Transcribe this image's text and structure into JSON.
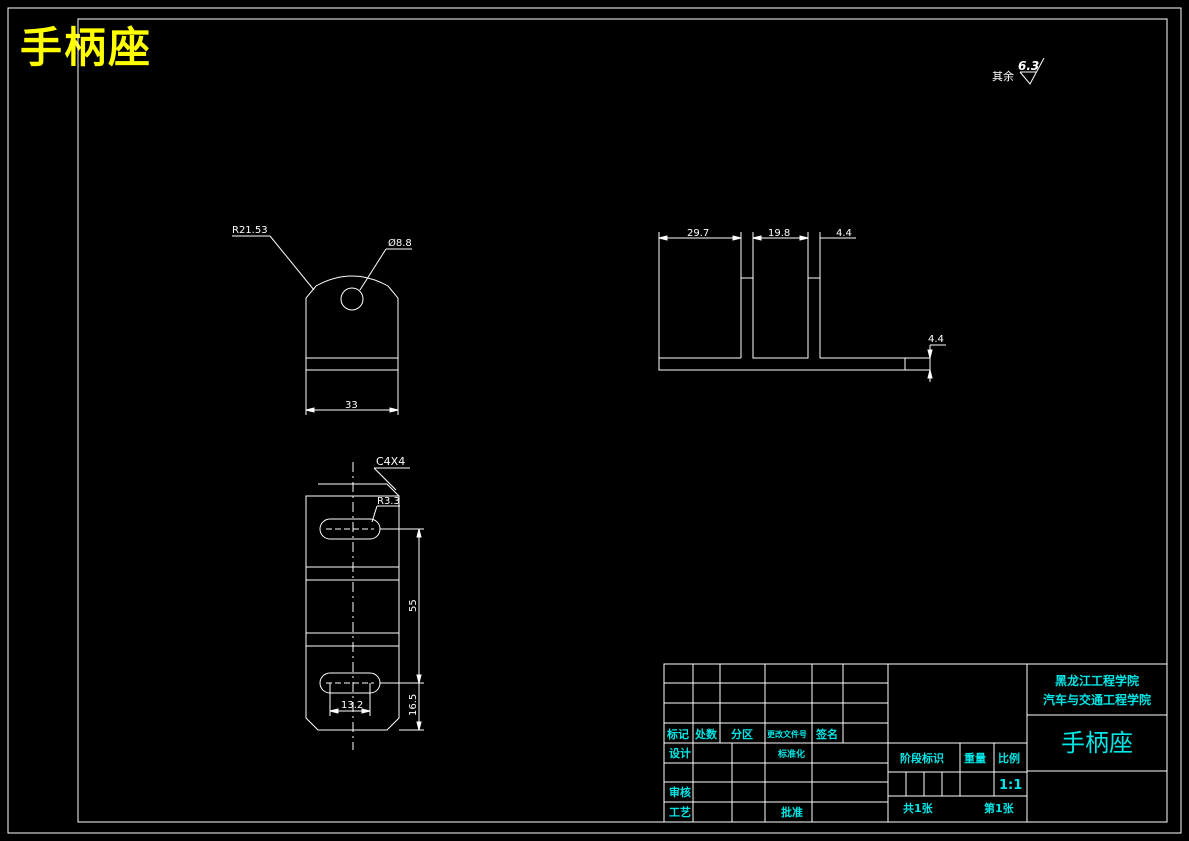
{
  "drawing": {
    "title": "手柄座",
    "surface_finish": {
      "prefix": "其余",
      "value": "6.3"
    }
  },
  "front_view": {
    "radius_label": "R21.53",
    "hole_label": "Ø8.8",
    "width_label": "33"
  },
  "side_view": {
    "dim_a": "29.7",
    "dim_b": "19.8",
    "dim_c": "4.4",
    "thickness": "4.4"
  },
  "bottom_view": {
    "chamfer_label": "C4X4",
    "slot_radius_label": "R3.3",
    "hole_spacing_label": "55",
    "edge_distance_label": "16.5",
    "slot_length_label": "13.2"
  },
  "title_block": {
    "school": "黑龙江工程学院",
    "department": "汽车与交通工程学院",
    "part_name": "手柄座",
    "col_mark": "标记",
    "col_count": "处数",
    "col_zone": "分区",
    "col_change_doc": "更改文件号",
    "col_sign": "签名",
    "row_design": "设计",
    "row_standard": "标准化",
    "row_review": "审核",
    "row_process": "工艺",
    "row_approve": "批准",
    "stage": "阶段标识",
    "weight": "重量",
    "scale_header": "比例",
    "scale_value": "1:1",
    "total_sheets": "共1张",
    "sheet_no": "第1张"
  }
}
